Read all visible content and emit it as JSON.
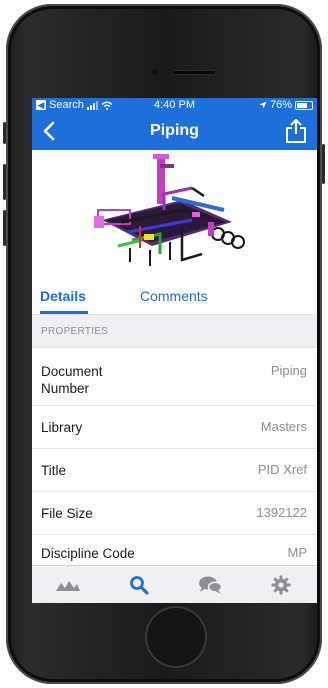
{
  "status_bar": {
    "back_app": "Search",
    "time": "4:40 PM",
    "battery": "76%"
  },
  "nav": {
    "title": "Piping",
    "back_icon": "chevron-left-icon",
    "share_icon": "share-icon"
  },
  "tabs": [
    {
      "label": "Details",
      "active": true
    },
    {
      "label": "Comments",
      "active": false
    }
  ],
  "section_header": "PROPERTIES",
  "properties": [
    {
      "label": "Document Number",
      "value": "Piping"
    },
    {
      "label": "Library",
      "value": "Masters"
    },
    {
      "label": "Title",
      "value": "PID Xref"
    },
    {
      "label": "File Size",
      "value": "1392122"
    },
    {
      "label": "Discipline Code",
      "value": "MP"
    }
  ],
  "tab_bar": [
    {
      "icon": "mountains-icon",
      "active": false
    },
    {
      "icon": "search-icon",
      "active": true
    },
    {
      "icon": "chat-bubbles-icon",
      "active": false
    },
    {
      "icon": "gear-icon",
      "active": false
    }
  ],
  "colors": {
    "brand_blue": "#1d6fd9",
    "icon_gray": "#8e8e93"
  }
}
